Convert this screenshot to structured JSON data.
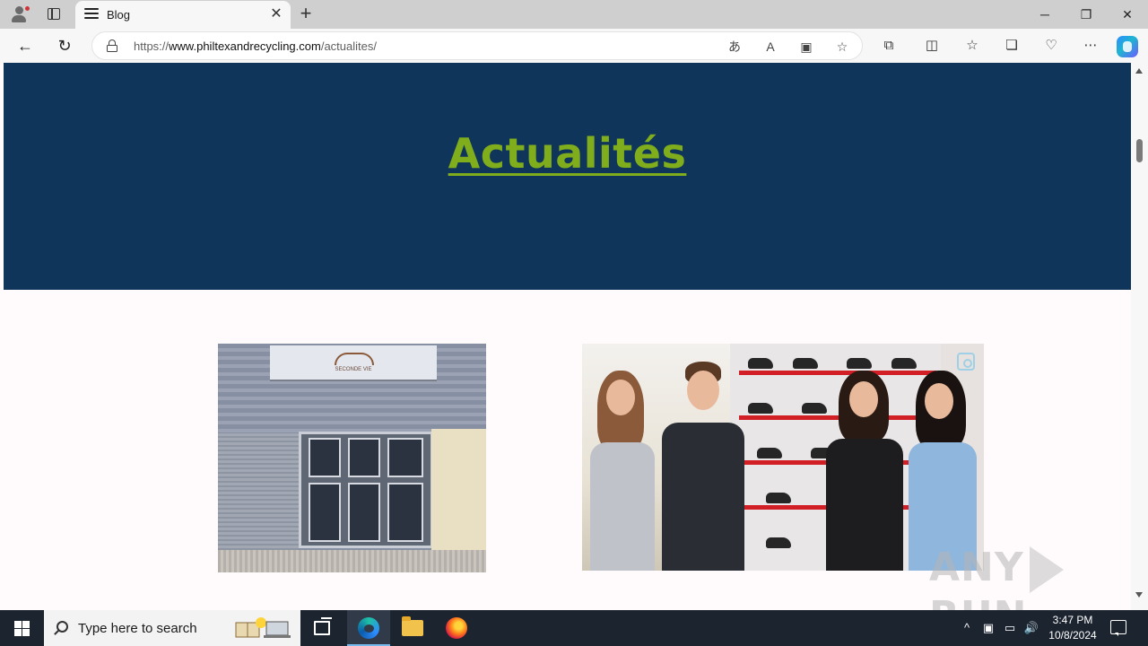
{
  "browser": {
    "tab": {
      "title": "Blog",
      "close_glyph": "✕"
    },
    "new_tab_glyph": "+",
    "window_controls": {
      "minimize": "─",
      "restore": "❐",
      "close": "✕"
    },
    "nav": {
      "back": "←",
      "refresh": "↻"
    },
    "address": {
      "url_prefix": "https://",
      "url_host": "www.philtexandrecycling.com",
      "url_path": "/actualites/"
    },
    "address_icons": [
      "translate-icon",
      "read-aloud-icon",
      "immersive-reader-icon",
      "favorite-star-icon"
    ],
    "toolbar_icons": [
      "extensions-icon",
      "split-screen-icon",
      "favorites-icon",
      "collections-icon",
      "browser-essentials-icon",
      "more-menu-icon",
      "copilot-icon"
    ]
  },
  "page": {
    "hero_title": "Actualités",
    "colors": {
      "hero_bg": "#10355b",
      "title_green": "#7fad1b",
      "page_bg": "#fffbfc"
    },
    "store_sign_text": "SECONDE VIE",
    "posts": [
      {
        "image": "storefront-photo"
      },
      {
        "image": "team-photo"
      }
    ]
  },
  "watermark": {
    "left": "ANY",
    "right": "RUN"
  },
  "taskbar": {
    "search_placeholder": "Type here to search",
    "apps": [
      "task-view-icon",
      "edge-icon",
      "file-explorer-icon",
      "firefox-icon"
    ],
    "tray": {
      "chevron": "^",
      "volume": "🔊"
    },
    "time": "3:47 PM",
    "date": "10/8/2024"
  }
}
